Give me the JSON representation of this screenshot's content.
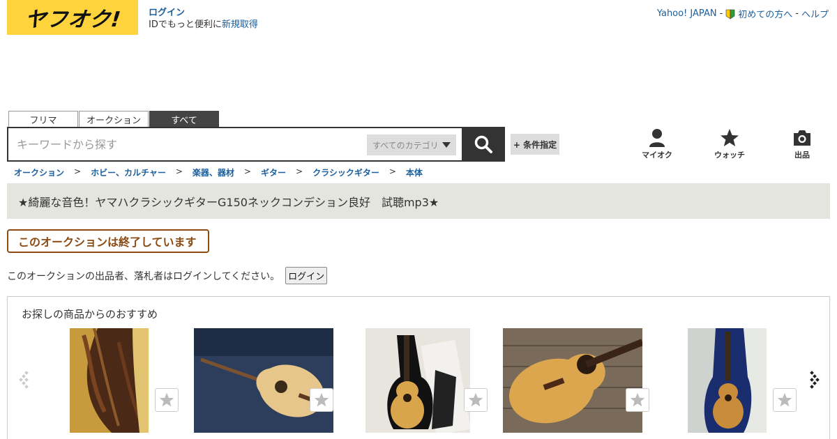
{
  "header": {
    "logo_text": "ヤフオク!",
    "login_label": "ログイン",
    "login_sub_prefix": "IDでもっと便利に",
    "signup_label": "新規取得",
    "links": {
      "yahoo_japan": "Yahoo! JAPAN",
      "sep1": " - ",
      "beginner": "初めての方へ",
      "sep2": " - ",
      "help": "ヘルプ"
    }
  },
  "search": {
    "tabs": [
      "フリマ",
      "オークション",
      "すべて"
    ],
    "active_tab": 2,
    "placeholder": "キーワードから探す",
    "category": "すべてのカテゴリ",
    "condition_button": "+ 条件指定"
  },
  "nav": {
    "my_auction": "マイオク",
    "watch": "ウォッチ",
    "sell": "出品"
  },
  "breadcrumb": [
    "オークション",
    "ホビー、カルチャー",
    "楽器、器材",
    "ギター",
    "クラシックギター",
    "本体"
  ],
  "listing": {
    "title": "★綺麗な音色！ヤマハクラシックギターG150ネックコンデション良好　試聴mp3★",
    "ended_notice": "このオークションは終了しています",
    "login_note": "このオークションの出品者、落札者はログインしてください。",
    "login_button": "ログイン"
  },
  "recommend": {
    "title": "お探しの商品からのおすすめ",
    "items": [
      {
        "icon": "guitar-closeup-photo"
      },
      {
        "icon": "guitar-on-blue-photo"
      },
      {
        "icon": "guitar-in-case-photo"
      },
      {
        "icon": "guitar-on-wood-photo"
      },
      {
        "icon": "guitar-blue-case-photo"
      }
    ]
  },
  "colors": {
    "brand_yellow": "#fed33c",
    "link_blue": "#1a5f9e",
    "ended_brown": "#8a4a12",
    "title_bg": "#e5e5e0"
  }
}
